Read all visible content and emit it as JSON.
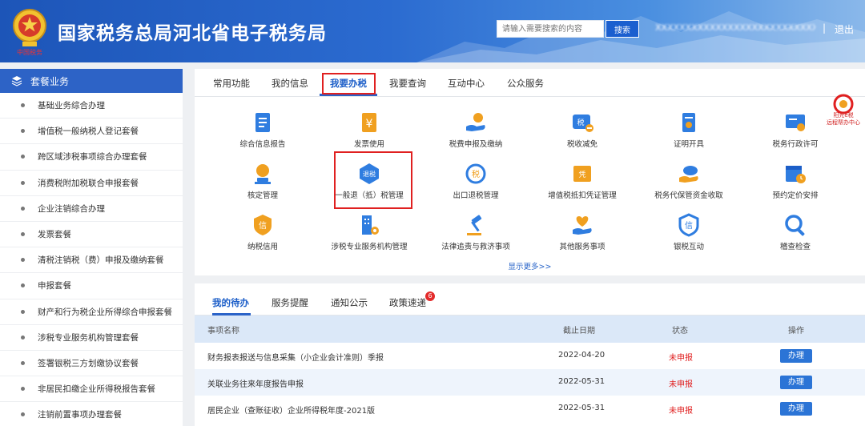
{
  "header": {
    "title": "国家税务总局河北省电子税务局",
    "emblem_caption": "中国税务",
    "search": {
      "placeholder": "请输入需要搜索的内容",
      "button_label": "搜索"
    },
    "user_name": "XXXXXXXXXXXXXXXXXXXXXXXXXXXXX",
    "separator": "|",
    "logout_label": "退出"
  },
  "sidebar": {
    "title": "套餐业务",
    "items": [
      {
        "label": "基础业务综合办理"
      },
      {
        "label": "增值税一般纳税人登记套餐"
      },
      {
        "label": "跨区域涉税事项综合办理套餐"
      },
      {
        "label": "消费税附加税联合申报套餐"
      },
      {
        "label": "企业注销综合办理"
      },
      {
        "label": "发票套餐"
      },
      {
        "label": "清税注销税（费）申报及缴纳套餐"
      },
      {
        "label": "申报套餐"
      },
      {
        "label": "财产和行为税企业所得综合申报套餐"
      },
      {
        "label": "涉税专业服务机构管理套餐"
      },
      {
        "label": "签署银税三方划缴协议套餐"
      },
      {
        "label": "非居民扣缴企业所得税报告套餐"
      },
      {
        "label": "注销前置事项办理套餐"
      }
    ]
  },
  "tabs": [
    {
      "label": "常用功能"
    },
    {
      "label": "我的信息"
    },
    {
      "label": "我要办税"
    },
    {
      "label": "我要查询"
    },
    {
      "label": "互动中心"
    },
    {
      "label": "公众服务"
    }
  ],
  "services": [
    {
      "label": "综合信息报告",
      "icon": "document-icon",
      "color": "#2f7de0"
    },
    {
      "label": "发票使用",
      "icon": "invoice-yen-icon",
      "color": "#f0a020"
    },
    {
      "label": "税费申报及缴纳",
      "icon": "hand-coin-icon",
      "color": "#f0a020"
    },
    {
      "label": "税收减免",
      "icon": "tax-reduce-icon",
      "color": "#2f7de0"
    },
    {
      "label": "证明开具",
      "icon": "certificate-icon",
      "color": "#2f7de0"
    },
    {
      "label": "税务行政许可",
      "icon": "license-icon",
      "color": "#2f7de0"
    },
    {
      "label": "核定管理",
      "icon": "stamp-icon",
      "color": "#f0a020"
    },
    {
      "label": "一般退（抵）税管理",
      "icon": "refund-icon",
      "color": "#2f7de0",
      "icon_text": "退税"
    },
    {
      "label": "出口退税管理",
      "icon": "export-refund-icon",
      "color": "#2f7de0",
      "icon_text": "税"
    },
    {
      "label": "增值税抵扣凭证管理",
      "icon": "voucher-icon",
      "color": "#f0a020",
      "icon_text": "凭"
    },
    {
      "label": "税务代保管资金收取",
      "icon": "cloud-hand-icon",
      "color": "#2f7de0"
    },
    {
      "label": "预约定价安排",
      "icon": "calendar-clock-icon",
      "color": "#2f7de0"
    },
    {
      "label": "纳税信用",
      "icon": "credit-icon",
      "color": "#f0a020",
      "icon_text": "信"
    },
    {
      "label": "涉税专业服务机构管理",
      "icon": "building-gear-icon",
      "color": "#2f7de0"
    },
    {
      "label": "法律追责与救济事项",
      "icon": "gavel-icon",
      "color": "#2f7de0"
    },
    {
      "label": "其他服务事项",
      "icon": "heart-hand-icon",
      "color": "#f0a020"
    },
    {
      "label": "银税互动",
      "icon": "bank-credit-icon",
      "color": "#2f7de0",
      "icon_text": "信"
    },
    {
      "label": "稽查检查",
      "icon": "magnifier-icon",
      "color": "#2f7de0"
    }
  ],
  "show_more_label": "显示更多>>",
  "side_logo": {
    "text": "阳光e税",
    "subtext": "远程帮办中心"
  },
  "todo": {
    "tabs": [
      {
        "label": "我的待办"
      },
      {
        "label": "服务提醒"
      },
      {
        "label": "通知公示"
      },
      {
        "label": "政策速递"
      }
    ],
    "badge": "6",
    "columns": {
      "name": "事项名称",
      "deadline": "截止日期",
      "status": "状态",
      "action": "操作"
    },
    "rows": [
      {
        "name": "财务报表报送与信息采集（小企业会计准则）季报",
        "deadline": "2022-04-20",
        "status": "未申报",
        "action": "办理"
      },
      {
        "name": "关联业务往来年度报告申报",
        "deadline": "2022-05-31",
        "status": "未申报",
        "action": "办理"
      },
      {
        "name": "居民企业（查账征收）企业所得税年度-2021版",
        "deadline": "2022-05-31",
        "status": "未申报",
        "action": "办理"
      }
    ]
  },
  "colors": {
    "brand_blue": "#2d63c6",
    "highlight_red": "#e02020",
    "orange": "#f0a020"
  }
}
